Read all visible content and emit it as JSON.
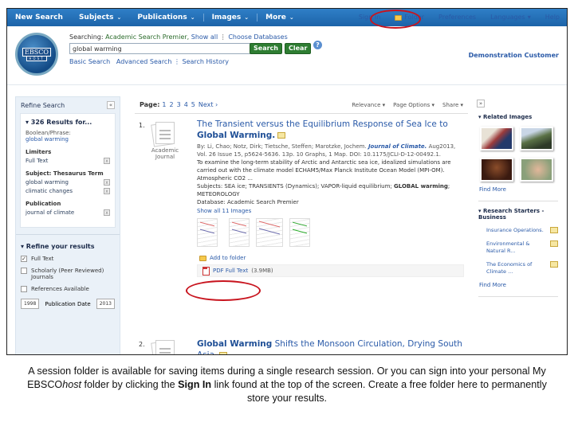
{
  "topbar": {
    "nav": [
      {
        "label": "New Search",
        "caret": false
      },
      {
        "label": "Subjects",
        "caret": true
      },
      {
        "label": "Publications",
        "caret": true
      },
      {
        "label": "Images",
        "caret": true
      },
      {
        "label": "More",
        "caret": true
      }
    ],
    "caret_glyph": "⌄",
    "signin": "Sign In",
    "folder": "Folder",
    "preferences": "Preferences",
    "languages": "Languages",
    "languages_caret": "▾",
    "help": "Help"
  },
  "header": {
    "logo_top": "EBSCO",
    "logo_bottom": "HOST",
    "searching_label": "Searching: ",
    "database": "Academic Search Premier,",
    "show_all": "Show all",
    "choose_databases": "Choose Databases",
    "search_value": "global warming",
    "search_button": "Search",
    "clear_button": "Clear",
    "help_glyph": "?",
    "basic_search": "Basic Search",
    "advanced_search": "Advanced Search",
    "search_history": "Search History",
    "customer": "Demonstration Customer"
  },
  "sidebar": {
    "title": "Refine Search",
    "collapse_glyph": "«",
    "results_header": "▾ 326 Results for...",
    "boolean_label": "Boolean/Phrase:",
    "boolean_value": "global warming",
    "limiters_label": "Limiters",
    "limiters": [
      "Full Text"
    ],
    "subject_label": "Subject: Thesaurus Term",
    "subjects": [
      "global warming",
      "climatic changes"
    ],
    "publication_label": "Publication",
    "publications": [
      "journal of climate"
    ],
    "remove_glyph": "x",
    "refine_title": "▾ Refine your results",
    "checkboxes": [
      {
        "label": "Full Text",
        "checked": true
      },
      {
        "label": "Scholarly (Peer Reviewed) Journals",
        "checked": false
      },
      {
        "label": "References Available",
        "checked": false
      }
    ],
    "date_from": "1998",
    "date_label": "Publication Date",
    "date_to": "2013"
  },
  "main": {
    "page_label": "Page:",
    "pages": [
      "1",
      "2",
      "3",
      "4",
      "5"
    ],
    "next": "Next ›",
    "options": [
      "Relevance ▾",
      "Page Options ▾",
      "Share ▾"
    ],
    "results": [
      {
        "number": "1.",
        "doctype": "Academic Journal",
        "title_plain": "The Transient versus the Equilibrium Response of Sea Ice to ",
        "title_bold": "Global Warming.",
        "authors": "By: Li, Chao; Notz, Dirk; Tietsche, Steffen; Marotzke, Jochem. ",
        "journal": "Journal of Climate.",
        "citation": " Aug2013, Vol. 26 Issue 15, p5624-5636. 13p. 10 Graphs, 1 Map. DOI: 10.1175/JCLI-D-12-00492.1.",
        "abstract": "To examine the long-term stability of Arctic and Antarctic sea ice, idealized simulations are carried out with the climate model ECHAM5/Max Planck Institute Ocean Model (MPI-OM). Atmospheric CO2 ...",
        "subjects_label": "Subjects: ",
        "subjects": "SEA ice; TRANSIENTS (Dynamics); VAPOR-liquid equilibrium; ",
        "subjects_bold": "GLOBAL warming",
        "subjects_tail": "; METEOROLOGY",
        "database": "Database: Academic Search Premier",
        "show_images": "Show all 11 Images",
        "add_to_folder": "Add to folder",
        "pdf_label": "PDF Full Text",
        "pdf_size": "(3.9MB)"
      },
      {
        "number": "2.",
        "title_bold": "Global Warming",
        "title_plain": " Shifts the Monsoon Circulation, Drying South Asia."
      }
    ]
  },
  "right_panel": {
    "expand_glyph": "»",
    "related_images_title": "▾ Related Images",
    "find_more": "Find More",
    "research_starters_title": "▾ Research Starters - Business",
    "research_starters": [
      "Insurance Operations.",
      "Environmental & Natural R...",
      "The Economics of Climate ..."
    ],
    "find_more_2": "Find More"
  },
  "caption": {
    "part1": "A session folder is available for saving items during a single research session. Or you can sign into your personal My EBSCO",
    "italic": "host",
    "part2": " folder by clicking the ",
    "bold": "Sign In",
    "part3": " link found at the top of the screen. Create a free folder here to permanently store your results."
  },
  "colors": {
    "topbar": "#1c63a8",
    "link": "#2a5aa8",
    "button_green": "#2e7d32",
    "highlight_oval": "#c8141e"
  }
}
